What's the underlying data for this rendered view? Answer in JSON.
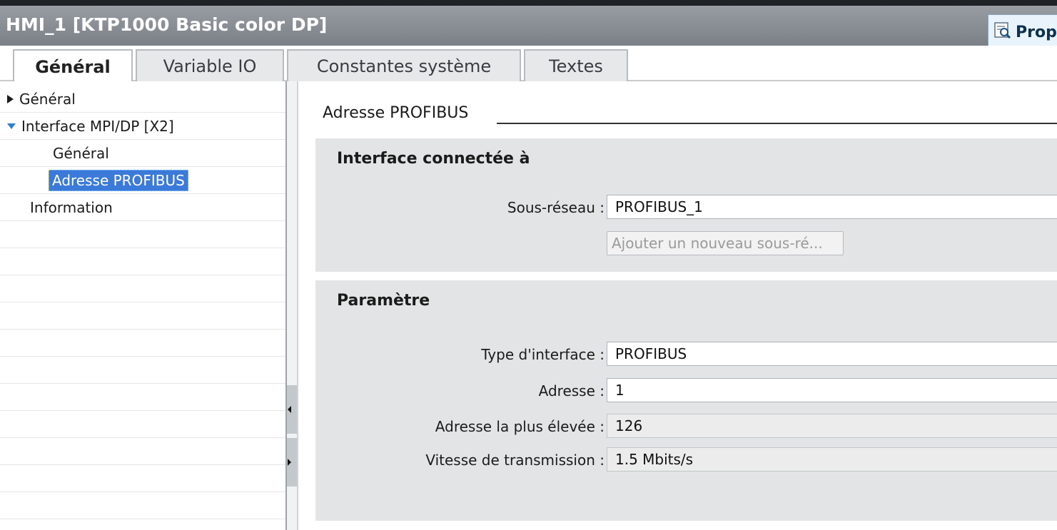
{
  "window": {
    "title": "HMI_1 [KTP1000 Basic color DP]",
    "properties_button_label": "Prop",
    "properties_icon": "magnifier-properties-icon"
  },
  "tabs": [
    {
      "label": "Général",
      "active": true
    },
    {
      "label": "Variable IO",
      "active": false
    },
    {
      "label": "Constantes système",
      "active": false
    },
    {
      "label": "Textes",
      "active": false
    }
  ],
  "nav": {
    "items": [
      {
        "label": "Général",
        "state": "collapsed"
      },
      {
        "label": "Interface MPI/DP [X2]",
        "state": "expanded"
      },
      {
        "label": "Général"
      },
      {
        "label": "Adresse PROFIBUS",
        "selected": true
      },
      {
        "label": "Information"
      }
    ]
  },
  "content": {
    "section_title": "Adresse PROFIBUS",
    "interface_group": {
      "title": "Interface connectée à",
      "subnet_label": "Sous-réseau :",
      "subnet_value": "PROFIBUS_1",
      "add_subnet_button": "Ajouter un nouveau sous-ré..."
    },
    "param_group": {
      "title": "Paramètre",
      "interface_type_label": "Type d'interface :",
      "interface_type_value": "PROFIBUS",
      "address_label": "Adresse :",
      "address_value": "1",
      "highest_address_label": "Adresse la plus élevée :",
      "highest_address_value": "126",
      "baud_rate_label": "Vitesse de transmission :",
      "baud_rate_value": "1.5 Mbits/s"
    }
  },
  "colors": {
    "titlebar": "#8a9096",
    "selection": "#3b7ad8",
    "group_bg": "#e3e4e5",
    "expand_triangle": "#2f7fd0"
  }
}
